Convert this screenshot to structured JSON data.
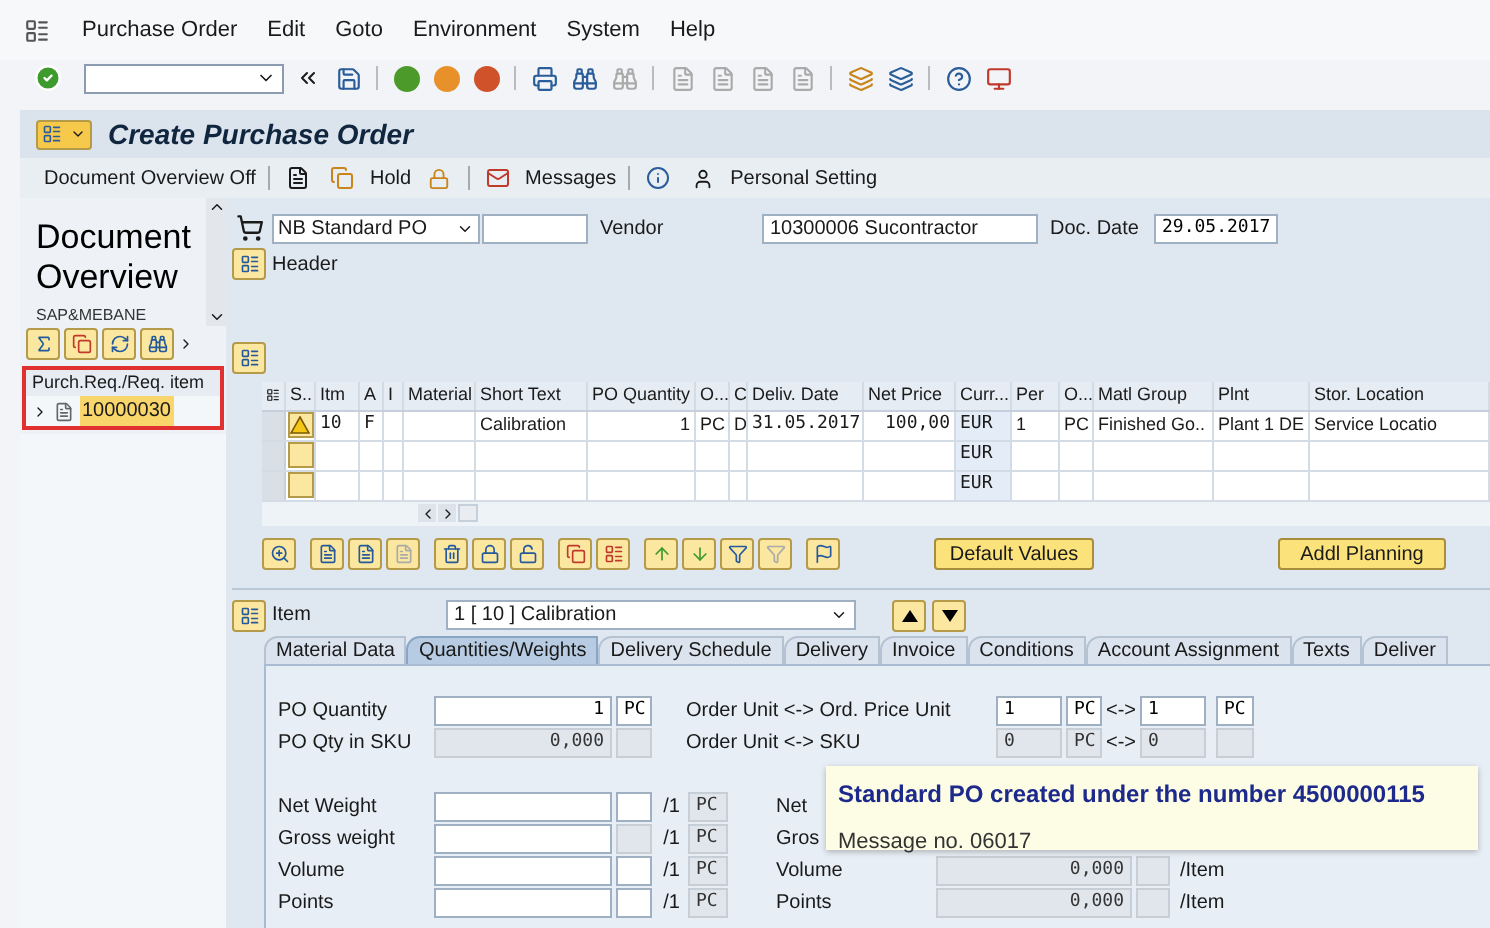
{
  "menu": [
    {
      "label": "Purchase Order"
    },
    {
      "label": "Edit"
    },
    {
      "label": "Goto"
    },
    {
      "label": "Environment"
    },
    {
      "label": "System"
    },
    {
      "label": "Help"
    }
  ],
  "title": "Create Purchase Order",
  "app_toolbar": [
    {
      "kind": "text",
      "label": "Document Overview Off"
    },
    {
      "kind": "icon",
      "label": "Hold"
    },
    {
      "kind": "icon",
      "label": "Messages"
    },
    {
      "kind": "icon",
      "label": "Personal Setting"
    }
  ],
  "overview": {
    "title": "Document Overview",
    "variant": "SAP&MEBANE",
    "tree_header": "Purch.Req./Req. item",
    "tree": [
      {
        "label": "10000030",
        "selected": true,
        "expanded": false
      }
    ]
  },
  "header": {
    "doc_type": "NB Standard PO",
    "vendor_label": "Vendor",
    "vendor": "10300006 Sucontractor",
    "doc_date_label": "Doc. Date",
    "doc_date": "29.05.2017",
    "header_button": "Header"
  },
  "items_table": {
    "columns": [
      "S..",
      "Itm",
      "A",
      "I",
      "Material",
      "Short Text",
      "PO Quantity",
      "O...",
      "C",
      "Deliv. Date",
      "Net Price",
      "Curr...",
      "Per",
      "O...",
      "Matl Group",
      "Plnt",
      "Stor. Location"
    ],
    "rows": [
      {
        "warning": true,
        "cells": [
          null,
          "10",
          "F",
          null,
          null,
          "Calibration",
          "1",
          "PC",
          "D",
          "31.05.2017",
          "100,00",
          "EUR",
          "1",
          "PC",
          "Finished Go..",
          "Plant 1 DE",
          "Service Locatio"
        ]
      },
      {
        "warning": false,
        "cells": [
          null,
          null,
          null,
          null,
          null,
          null,
          null,
          null,
          null,
          null,
          null,
          "EUR",
          null,
          null,
          null,
          null,
          null
        ]
      },
      {
        "warning": false,
        "cells": [
          null,
          null,
          null,
          null,
          null,
          null,
          null,
          null,
          null,
          null,
          null,
          "EUR",
          null,
          null,
          null,
          null,
          null
        ]
      }
    ]
  },
  "buttons": [
    "Default Values",
    "Addl Planning"
  ],
  "item": {
    "label": "Item",
    "value": "1 [ 10 ] Calibration"
  },
  "tabs": [
    {
      "label": "Material Data",
      "selected": false
    },
    {
      "label": "Quantities/Weights",
      "selected": true
    },
    {
      "label": "Delivery Schedule",
      "selected": false
    },
    {
      "label": "Delivery",
      "selected": false
    },
    {
      "label": "Invoice",
      "selected": false
    },
    {
      "label": "Conditions",
      "selected": false
    },
    {
      "label": "Account Assignment",
      "selected": false
    },
    {
      "label": "Texts",
      "selected": false
    },
    {
      "label": "Deliver",
      "selected": false
    }
  ],
  "quantities": {
    "po_quantity": {
      "label": "PO Quantity",
      "value": "1",
      "unit": "PC"
    },
    "po_qty_sku": {
      "label": "PO Qty in SKU",
      "value": "0,000",
      "disabled": true
    },
    "conversions": [
      {
        "label": "Order Unit <-> Ord. Price Unit",
        "from": "1",
        "from_unit": "PC",
        "arrow": "<->",
        "to": "1",
        "to_unit": "PC",
        "disabled": false
      },
      {
        "label": "Order Unit <-> SKU",
        "from": "0",
        "from_unit": "PC",
        "arrow": "<->",
        "to": "0",
        "disabled": true
      }
    ],
    "measures": [
      {
        "label": "Net Weight",
        "per": "/1",
        "unit": "PC",
        "unit_disabled": false
      },
      {
        "label": "Gross weight",
        "per": "/1",
        "unit": "PC",
        "unit_disabled": true
      },
      {
        "label": "Volume",
        "per": "/1",
        "unit": "PC",
        "unit_disabled": false
      },
      {
        "label": "Points",
        "per": "/1",
        "unit": "PC",
        "unit_disabled": false
      }
    ],
    "totals": [
      {
        "label": "Net"
      },
      {
        "label": "Gros"
      },
      {
        "label": "Volume",
        "value": "0,000",
        "per": "/Item"
      },
      {
        "label": "Points",
        "value": "0,000",
        "per": "/Item"
      }
    ]
  },
  "message": {
    "title": "Standard PO created under the number 4500000115",
    "detail": "Message no. 06017"
  }
}
